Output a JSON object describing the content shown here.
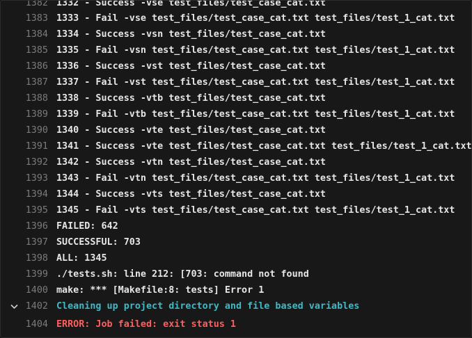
{
  "lines": [
    {
      "num": "1382",
      "text": "1332 - Success -vse test_files/test_case_cat.txt",
      "style": "normal"
    },
    {
      "num": "1383",
      "text": "1333 - Fail -vse test_files/test_case_cat.txt test_files/test_1_cat.txt",
      "style": "normal"
    },
    {
      "num": "1384",
      "text": "1334 - Success -vsn test_files/test_case_cat.txt",
      "style": "normal"
    },
    {
      "num": "1385",
      "text": "1335 - Fail -vsn test_files/test_case_cat.txt test_files/test_1_cat.txt",
      "style": "normal"
    },
    {
      "num": "1386",
      "text": "1336 - Success -vst test_files/test_case_cat.txt",
      "style": "normal"
    },
    {
      "num": "1387",
      "text": "1337 - Fail -vst test_files/test_case_cat.txt test_files/test_1_cat.txt",
      "style": "normal"
    },
    {
      "num": "1388",
      "text": "1338 - Success -vtb test_files/test_case_cat.txt",
      "style": "normal"
    },
    {
      "num": "1389",
      "text": "1339 - Fail -vtb test_files/test_case_cat.txt test_files/test_1_cat.txt",
      "style": "normal"
    },
    {
      "num": "1390",
      "text": "1340 - Success -vte test_files/test_case_cat.txt",
      "style": "normal"
    },
    {
      "num": "1391",
      "text": "1341 - Success -vte test_files/test_case_cat.txt test_files/test_1_cat.txt",
      "style": "normal"
    },
    {
      "num": "1392",
      "text": "1342 - Success -vtn test_files/test_case_cat.txt",
      "style": "normal"
    },
    {
      "num": "1393",
      "text": "1343 - Fail -vtn test_files/test_case_cat.txt test_files/test_1_cat.txt",
      "style": "normal"
    },
    {
      "num": "1394",
      "text": "1344 - Success -vts test_files/test_case_cat.txt",
      "style": "normal"
    },
    {
      "num": "1395",
      "text": "1345 - Fail -vts test_files/test_case_cat.txt test_files/test_1_cat.txt",
      "style": "normal"
    },
    {
      "num": "1396",
      "text": "FAILED: 642",
      "style": "normal"
    },
    {
      "num": "1397",
      "text": "SUCCESSFUL: 703",
      "style": "normal"
    },
    {
      "num": "1398",
      "text": "ALL: 1345",
      "style": "normal"
    },
    {
      "num": "1399",
      "text": "./tests.sh: line 212: [703: command not found",
      "style": "normal"
    },
    {
      "num": "1400",
      "text": "make: *** [Makefile:8: tests] Error 1",
      "style": "normal"
    },
    {
      "num": "1402",
      "text": "Cleaning up project directory and file based variables",
      "style": "section",
      "collapsible": true,
      "chevron_icon": "chevron-down-icon"
    },
    {
      "num": "1404",
      "text": "ERROR: Job failed: exit status 1",
      "style": "error"
    }
  ],
  "colors": {
    "background": "#181818",
    "line_number": "#7b7b7b",
    "text": "#e6e6e6",
    "section": "#3fb9c6",
    "error": "#ff5f5f"
  }
}
